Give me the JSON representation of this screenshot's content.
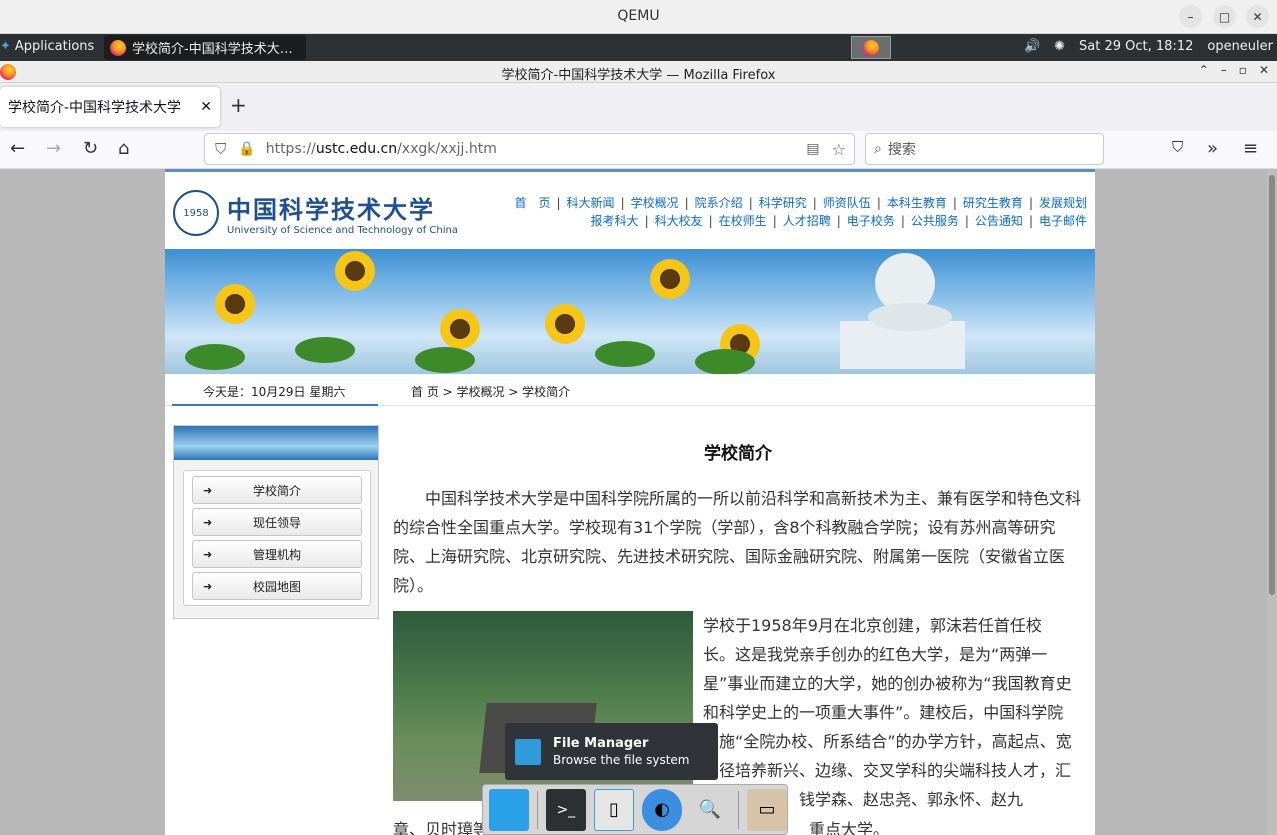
{
  "qemu": {
    "title": "QEMU"
  },
  "panel": {
    "applications_label": "Applications",
    "task_title": "学校简介-中国科学技术大…",
    "datetime": "Sat 29 Oct, 18:12",
    "user": "openeuler"
  },
  "firefox": {
    "window_title": "学校简介-中国科学技术大学 — Mozilla Firefox",
    "tab_title": "学校简介-中国科学技术大学",
    "url_prefix": "https://",
    "url_host": "ustc.edu.cn",
    "url_path": "/xxgk/xxjj.htm",
    "search_placeholder": "搜索"
  },
  "site": {
    "logo_cn": "中国科学技术大学",
    "logo_en": "University of Science and Technology of China",
    "seal_text": "1958",
    "menu_row1": [
      "首　页",
      "科大新闻",
      "学校概况",
      "院系介绍",
      "科学研究",
      "师资队伍",
      "本科生教育",
      "研究生教育",
      "发展规划"
    ],
    "menu_row2": [
      "报考科大",
      "科大校友",
      "在校师生",
      "人才招聘",
      "电子校务",
      "公共服务",
      "公告通知",
      "电子邮件"
    ],
    "today": "今天是：10月29日 星期六",
    "breadcrumb": "首 页 > 学校概况 > 学校简介",
    "sidebar": [
      "学校简介",
      "现任领导",
      "管理机构",
      "校园地图"
    ],
    "heading": "学校简介",
    "para1": "中国科学技术大学是中国科学院所属的一所以前沿科学和高新技术为主、兼有医学和特色文科的综合性全国重点大学。学校现有31个学院（学部），含8个科教融合学院；设有苏州高等研究院、上海研究院、北京研究院、先进技术研究院、国际金融研究院、附属第一医院（安徽省立医院）。",
    "para2": "学校于1958年9月在北京创建，郭沫若任首任校长。这是我党亲手创办的红色大学，是为“两弹一星”事业而建立的大学，她的创办被称为“我国教育史和科学史上的一项重大事件”。建校后，中国科学院实施“全院办校、所系结合”的办学方针，高起点、宽口径培养新兴、边缘、交叉学科的尖端科技人才，汇集了华罗庚、钱学森、赵忠尧、郭永怀、赵九",
    "para3": "章、贝时璋等",
    "para3_tail": "重点大学。"
  },
  "tooltip": {
    "title": "File Manager",
    "subtitle": "Browse the file system"
  },
  "colors": {
    "link": "#0a6ad0",
    "brand": "#1d4f91",
    "panel": "#2e3134"
  }
}
